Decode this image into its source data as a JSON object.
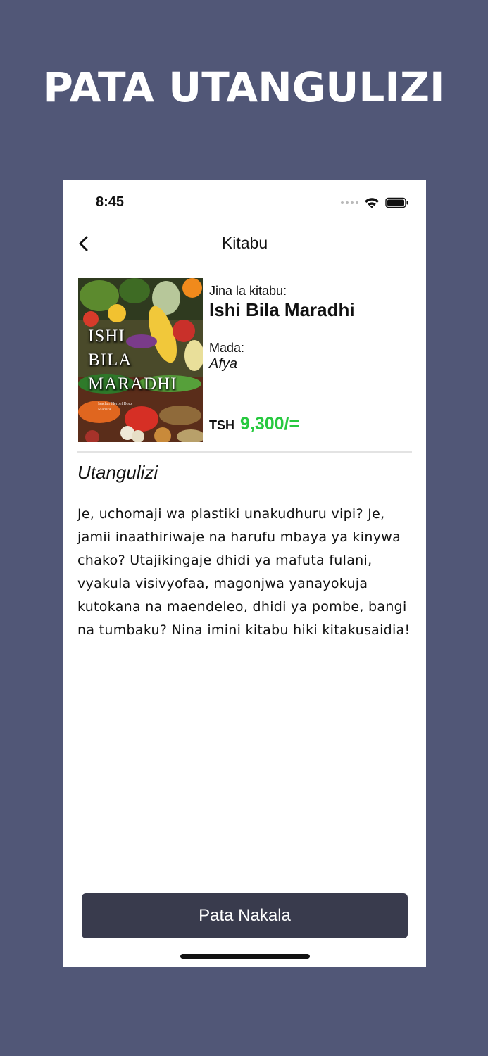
{
  "promo": {
    "heading": "PATA UTANGULIZI"
  },
  "status_bar": {
    "time": "8:45",
    "icons": [
      "signal-dots-icon",
      "wifi-icon",
      "battery-icon"
    ]
  },
  "nav": {
    "title": "Kitabu",
    "back_icon": "chevron-left-icon"
  },
  "book": {
    "cover_title": "ISHI\nBILA\nMARADHI",
    "cover_subtitle": "Isachar Heroel Boaz\nMahara",
    "name_label": "Jina la kitabu:",
    "title": "Ishi Bila Maradhi",
    "subject_label": "Mada:",
    "subject": "Afya",
    "currency": "TSH",
    "price": "9,300/="
  },
  "intro": {
    "title": "Utangulizi",
    "text": "Je, uchomaji wa plastiki unakudhuru vipi? Je, jamii inaathiriwaje na harufu mbaya ya kinywa chako? Utajikingaje dhidi ya mafuta fulani, vyakula visivyofaa, magonjwa yanayokuja kutokana na maendeleo, dhidi ya pombe, bangi na tumbaku? Nina imini kitabu hiki kitakusaidia!"
  },
  "cta": {
    "label": "Pata Nakala"
  },
  "colors": {
    "background": "#515777",
    "price": "#27c93f",
    "button": "#393b4d"
  }
}
